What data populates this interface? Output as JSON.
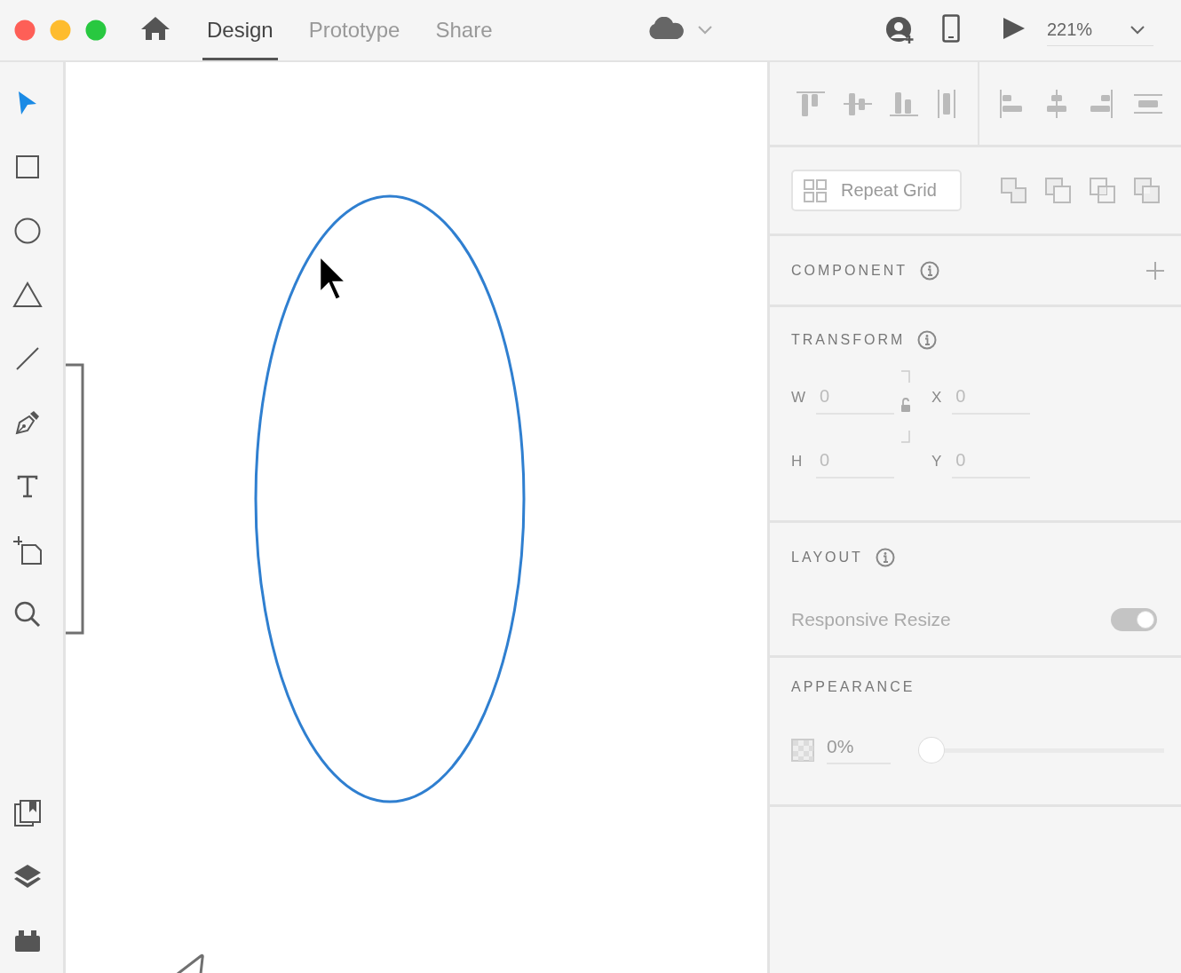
{
  "traffic_lights": [
    {
      "color": "#fe5f57"
    },
    {
      "color": "#febc2e"
    },
    {
      "color": "#28c840"
    }
  ],
  "tabs": [
    {
      "label": "Design",
      "selected": true
    },
    {
      "label": "Prototype",
      "selected": false
    },
    {
      "label": "Share",
      "selected": false
    }
  ],
  "zoom": {
    "value": "221%"
  },
  "tools": [
    {
      "kind": "select",
      "selected": true
    },
    {
      "kind": "rectangle",
      "selected": false
    },
    {
      "kind": "ellipse",
      "selected": false
    },
    {
      "kind": "polygon",
      "selected": false
    },
    {
      "kind": "line",
      "selected": false
    },
    {
      "kind": "pen",
      "selected": false
    },
    {
      "kind": "text",
      "selected": false
    },
    {
      "kind": "artboard",
      "selected": false
    },
    {
      "kind": "zoom",
      "selected": false
    }
  ],
  "bottom_tools": [
    {
      "kind": "assets",
      "selected": false
    },
    {
      "kind": "layers",
      "selected": false
    },
    {
      "kind": "plugins",
      "selected": false
    }
  ],
  "canvas": {
    "ellipse": {
      "selected": true
    }
  },
  "repeat_grid_button": {
    "label": "Repeat Grid"
  },
  "component": {
    "title": "COMPONENT"
  },
  "transform": {
    "title": "TRANSFORM",
    "fields": [
      {
        "label": "W",
        "placeholder": "0"
      },
      {
        "label": "X",
        "placeholder": "0"
      },
      {
        "label": "H",
        "placeholder": "0"
      },
      {
        "label": "Y",
        "placeholder": "0"
      }
    ]
  },
  "layout": {
    "title": "LAYOUT",
    "responsive_resize": {
      "label": "Responsive Resize",
      "on": true
    }
  },
  "appearance": {
    "title": "APPEARANCE",
    "opacity": {
      "value": "0%",
      "level": 0
    }
  }
}
